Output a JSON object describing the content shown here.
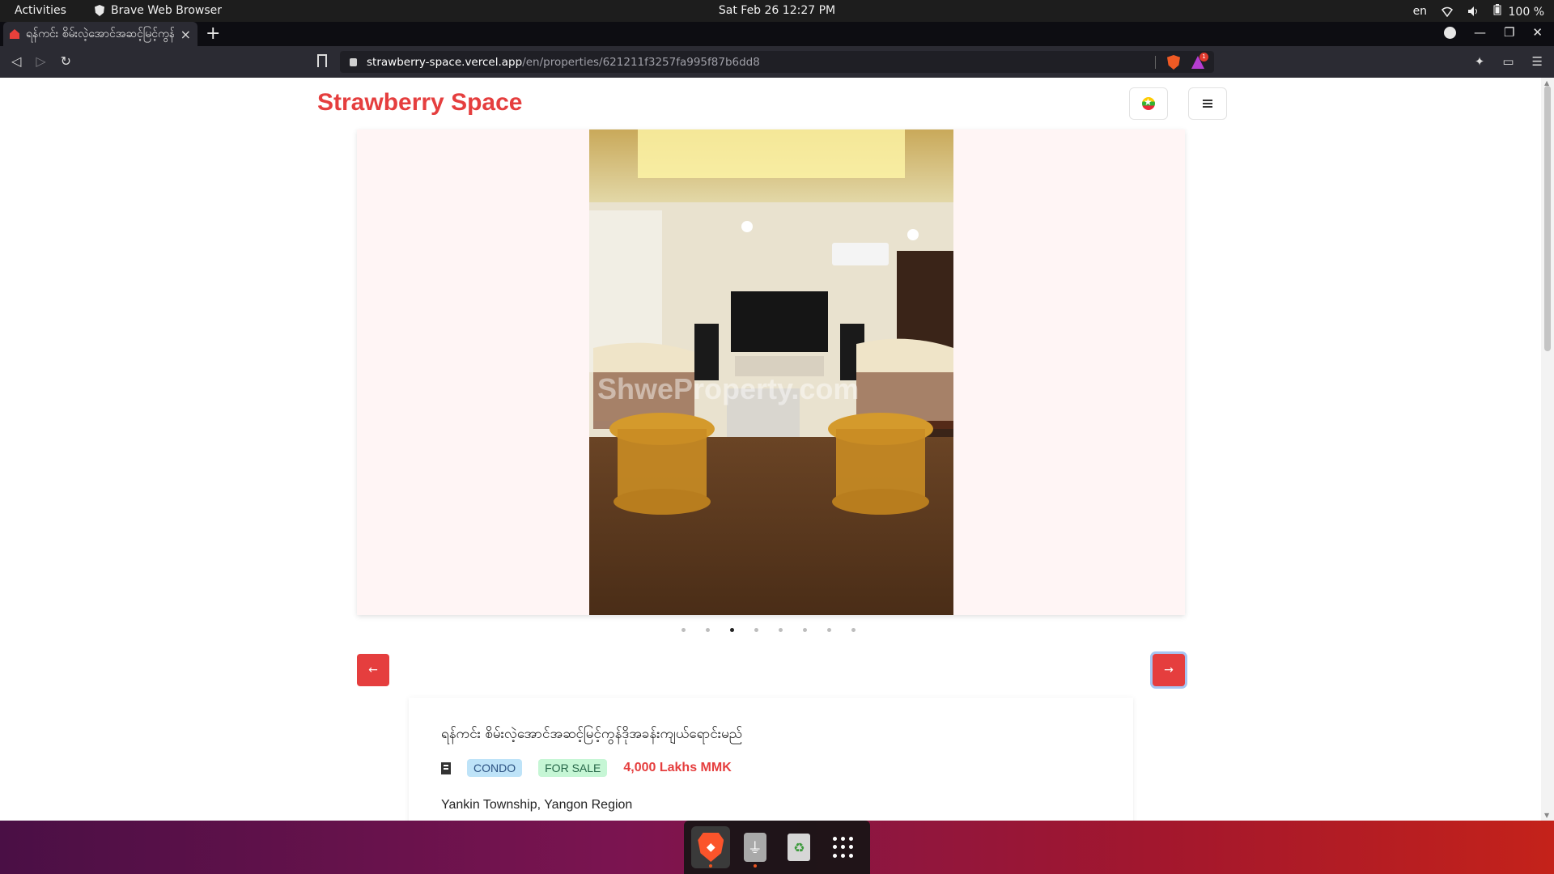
{
  "system": {
    "activities": "Activities",
    "app_name": "Brave Web Browser",
    "clock": "Sat Feb 26  12:27 PM",
    "lang": "en",
    "battery": "100 %"
  },
  "browser": {
    "tab_title": "ရန်ကင်း စိမ်းလဲ့အောင်အဆင့်မြင့်ကွန်ဒိုအခန်းကျယ်ရောင်းမည်",
    "new_tab": "+",
    "tab_close": "×",
    "url_host": "strawberry-space.vercel.app",
    "url_path": "/en/properties/621211f3257fa995f87b6dd8",
    "rewards_count": "1"
  },
  "page": {
    "brand": "Strawberry Space",
    "watermark": "ShweProperty.com",
    "carousel": {
      "slide_count": 8,
      "active_index": 2,
      "prev_label": "←",
      "next_label": "→"
    },
    "listing": {
      "title": "ရန်ကင်း စိမ်းလဲ့အောင်အဆင့်မြင့်ကွန်ဒိုအခန်းကျယ်ရောင်းမည်",
      "type": "CONDO",
      "status": "FOR SALE",
      "price": "4,000 Lakhs MMK",
      "location": "Yankin Township, Yangon Region"
    }
  },
  "colors": {
    "brand": "#e53e3e",
    "carousel_bg": "#fff5f5"
  }
}
